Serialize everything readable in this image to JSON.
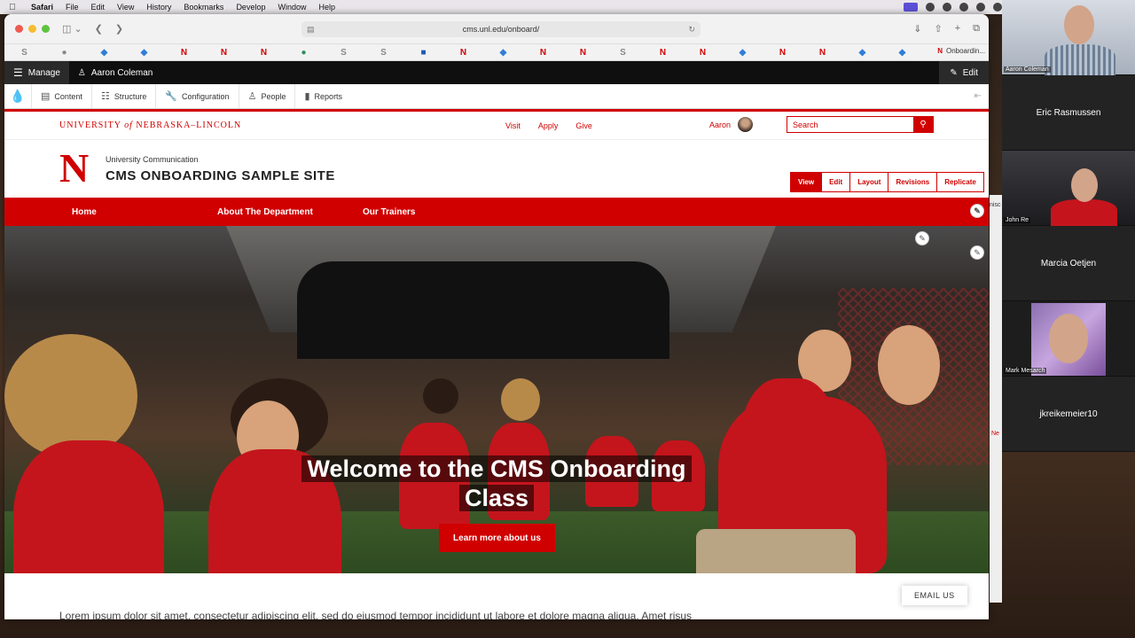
{
  "menubar": {
    "app": "Safari",
    "items": [
      "File",
      "Edit",
      "View",
      "History",
      "Bookmarks",
      "Develop",
      "Window",
      "Help"
    ]
  },
  "browser": {
    "url": "cms.unl.edu/onboard/",
    "favorites_last": "Onboardin..."
  },
  "drupal": {
    "manage_label": "Manage",
    "user_name": "Aaron Coleman",
    "edit_label": "Edit",
    "admin_items": [
      "Content",
      "Structure",
      "Configuration",
      "People",
      "Reports"
    ]
  },
  "unl": {
    "university_pre": "UNIVERSITY",
    "university_of": "of",
    "university_post": "NEBRASKA–LINCOLN",
    "links": [
      "Visit",
      "Apply",
      "Give"
    ],
    "user": "Aaron",
    "search_placeholder": "Search"
  },
  "site": {
    "subtitle": "University Communication",
    "title": "CMS ONBOARDING SAMPLE SITE",
    "tabs": [
      "View",
      "Edit",
      "Layout",
      "Revisions",
      "Replicate"
    ],
    "active_tab": "View"
  },
  "nav": {
    "items": [
      "Home",
      "About The Department",
      "Our Trainers"
    ]
  },
  "hero": {
    "title_line1": "Welcome to the CMS Onboarding",
    "title_line2": "Class",
    "button": "Learn more about us"
  },
  "content": {
    "lorem": "Lorem ipsum dolor sit amet, consectetur adipiscing elit, sed do eiusmod tempor incididunt ut labore et dolore magna aliqua. Amet risus",
    "email_us": "EMAIL US"
  },
  "zoom": {
    "participants": [
      "Aaron Coleman",
      "Eric Rasmussen",
      "John Re",
      "Marcia Oetjen",
      "Mark Mesarch",
      "jkreikemeier10"
    ]
  },
  "side": {
    "m1": "nisc",
    "m2": "Ne"
  },
  "colors": {
    "unl_red": "#d00000",
    "drupal_black": "#0f0f0f"
  }
}
